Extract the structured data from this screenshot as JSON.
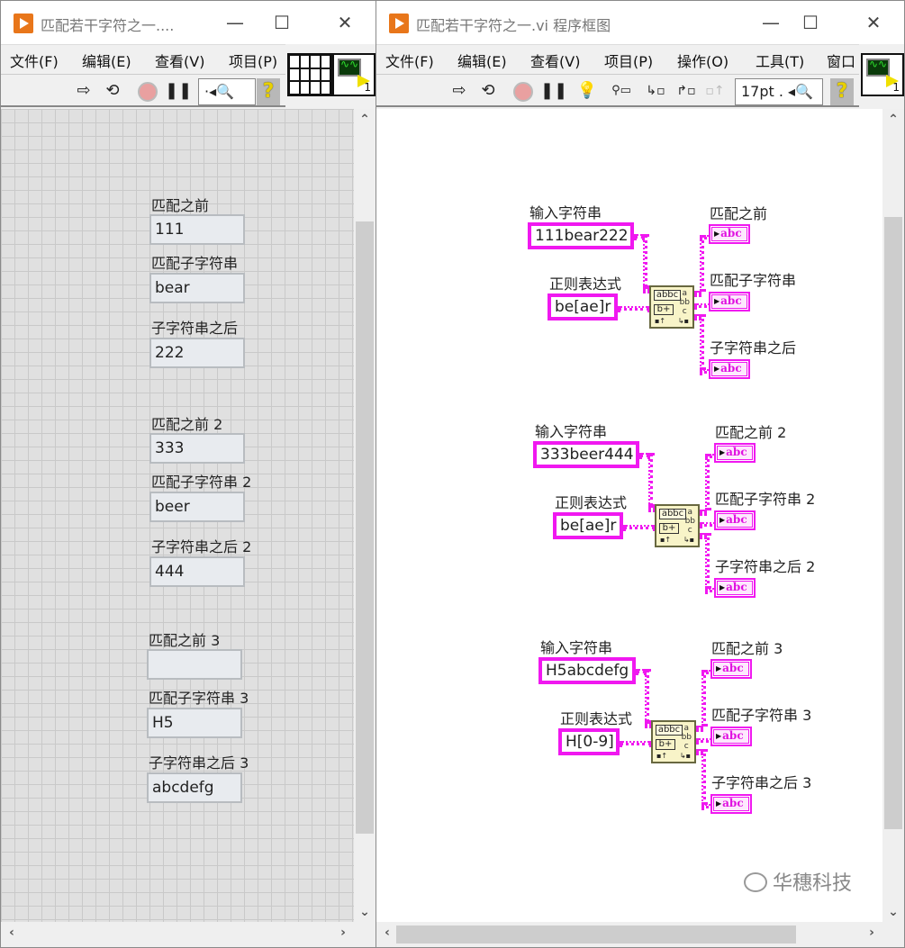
{
  "front_panel_window": {
    "title": "匹配若干字符之一....",
    "menu": [
      "文件(F)",
      "编辑(E)",
      "查看(V)",
      "项目(P)"
    ],
    "toolbar": {
      "search_text": "·◂",
      "help": "?"
    },
    "vi_icon_number": "1",
    "indicators": [
      {
        "label": "匹配之前",
        "value": "111"
      },
      {
        "label": "匹配子字符串",
        "value": "bear"
      },
      {
        "label": "子字符串之后",
        "value": "222"
      },
      {
        "label": "匹配之前 2",
        "value": "333"
      },
      {
        "label": "匹配子字符串 2",
        "value": "beer"
      },
      {
        "label": "子字符串之后 2",
        "value": "444"
      },
      {
        "label": "匹配之前 3",
        "value": ""
      },
      {
        "label": "匹配子字符串 3",
        "value": "H5"
      },
      {
        "label": "子字符串之后 3",
        "value": "abcdefg"
      }
    ]
  },
  "block_diagram_window": {
    "title": "匹配若干字符之一.vi 程序框图",
    "menu": [
      "文件(F)",
      "编辑(E)",
      "查看(V)",
      "项目(P)",
      "操作(O)",
      "工具(T)",
      "窗口"
    ],
    "toolbar": {
      "font_size": "17pt . ◂",
      "help": "?"
    },
    "vi_icon_number": "1",
    "groups": [
      {
        "input_label": "输入字符串",
        "input_value": "111bear222",
        "regex_label": "正则表达式",
        "regex_value": "be[ae]r",
        "outputs": [
          "匹配之前",
          "匹配子字符串",
          "子字符串之后"
        ]
      },
      {
        "input_label": "输入字符串",
        "input_value": "333beer444",
        "regex_label": "正则表达式",
        "regex_value": "be[ae]r",
        "outputs": [
          "匹配之前 2",
          "匹配子字符串 2",
          "子字符串之后 2"
        ]
      },
      {
        "input_label": "输入字符串",
        "input_value": "H5abcdefg",
        "regex_label": "正则表达式",
        "regex_value": "H[0-9]",
        "outputs": [
          "匹配之前 3",
          "匹配子字符串 3",
          "子字符串之后 3"
        ]
      }
    ],
    "indicator_glyph": "abc",
    "function_node": {
      "r1": "abbc",
      "r2": "b+",
      "r3": "a\nbb\nc"
    },
    "watermark": "华穗科技"
  },
  "window_controls": {
    "minimize": "—",
    "maximize": "☐",
    "close": "✕"
  }
}
